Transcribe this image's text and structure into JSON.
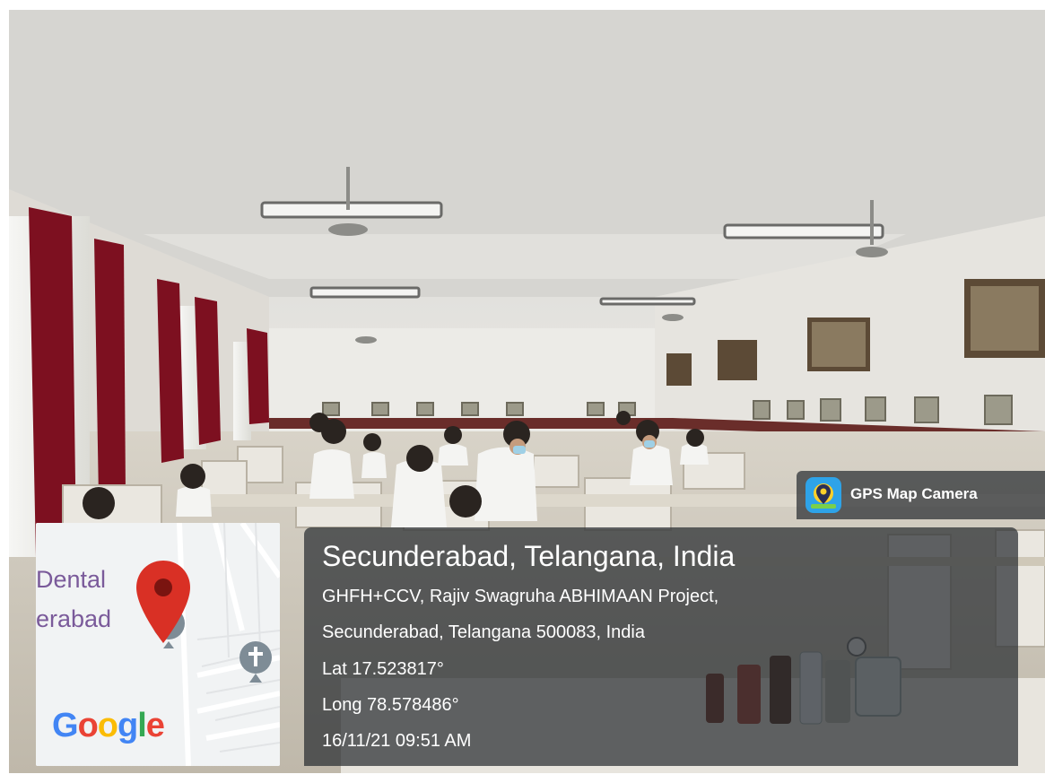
{
  "overlay": {
    "app_name": "GPS Map Camera",
    "location_title": "Secunderabad, Telangana, India",
    "address_line1": "GHFH+CCV, Rajiv Swagruha ABHIMAAN Project,",
    "address_line2": "Secunderabad, Telangana 500083, India",
    "latitude": "Lat 17.523817°",
    "longitude": "Long 78.578486°",
    "datetime": "16/11/21 09:51 AM"
  },
  "map": {
    "labels": [
      "Dental",
      "erabad"
    ],
    "logo_text": [
      "G",
      "o",
      "o",
      "g",
      "l",
      "e"
    ],
    "logo_colors": [
      "#4285F4",
      "#EA4335",
      "#FBBC05",
      "#4285F4",
      "#34A853",
      "#EA4335"
    ],
    "pin_color": "#d93025",
    "icons": [
      "location-pin-icon",
      "church-cross-icon",
      "poi-hand-icon"
    ]
  },
  "colors": {
    "curtain": "#7d1020",
    "wall": "#e8e6e2",
    "overlay_bg": "#282c30"
  }
}
